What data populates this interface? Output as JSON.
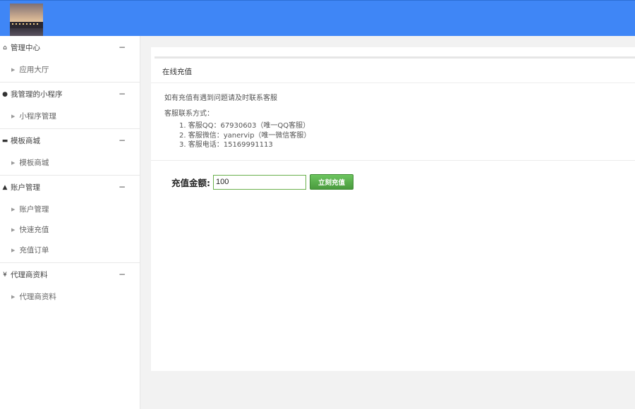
{
  "header": {
    "logo": "avatar"
  },
  "sidebar": {
    "groups": [
      {
        "icon": "home-icon",
        "glyph": "⌂",
        "title": "管理中心",
        "collapse": "−",
        "items": [
          "应用大厅"
        ]
      },
      {
        "icon": "wechat-icon",
        "glyph": "●",
        "title": "我管理的小程序",
        "collapse": "−",
        "items": [
          "小程序管理"
        ]
      },
      {
        "icon": "cart-icon",
        "glyph": "▬",
        "title": "模板商城",
        "collapse": "−",
        "items": [
          "模板商城"
        ]
      },
      {
        "icon": "user-icon",
        "glyph": "▲",
        "title": "账户管理",
        "collapse": "−",
        "items": [
          "账户管理",
          "快速充值",
          "充值订单"
        ]
      },
      {
        "icon": "yen-icon",
        "glyph": "¥",
        "title": "代理商资料",
        "collapse": "−",
        "items": [
          "代理商资料"
        ]
      }
    ]
  },
  "main": {
    "title": "在线充值",
    "notice": "如有充值有遇到问题请及时联系客服",
    "contact_label": "客服联系方式：",
    "contacts": [
      "1. 客服QQ：67930603（唯一QQ客服）",
      "2. 客服微信：yanervip（唯一微信客服）",
      "3. 客服电话：15169991113"
    ],
    "amount_label": "充值金额:",
    "amount_value": "100",
    "submit_label": "立刻充值"
  },
  "colors": {
    "topbar": "#3f86f6",
    "button": "#5cb85c"
  }
}
